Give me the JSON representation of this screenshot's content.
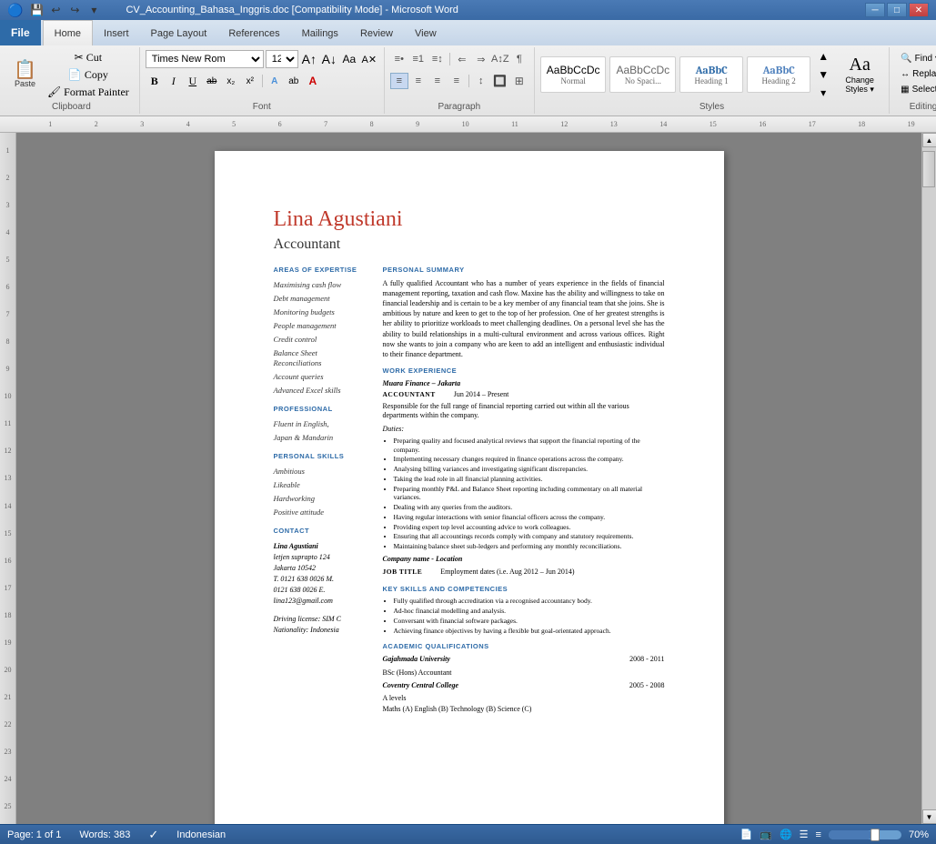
{
  "titlebar": {
    "title": "CV_Accounting_Bahasa_Inggris.doc [Compatibility Mode] - Microsoft Word",
    "minimize": "─",
    "maximize": "□",
    "close": "✕"
  },
  "tabs": {
    "file": "File",
    "home": "Home",
    "insert": "Insert",
    "pageLayout": "Page Layout",
    "references": "References",
    "mailings": "Mailings",
    "review": "Review",
    "view": "View"
  },
  "font": {
    "face": "Times New Rom",
    "size": "12",
    "bold": "B",
    "italic": "I",
    "underline": "U",
    "strikethrough": "ab",
    "subscript": "x₂",
    "superscript": "x²"
  },
  "paragraph": {
    "bullets": "bullets",
    "numbering": "numbering",
    "indent_decrease": "←",
    "indent_increase": "→",
    "sort": "sort",
    "show_marks": "¶"
  },
  "styles": {
    "normal_label": "Normal",
    "normal_sublabel": "¶ Normal",
    "nospace_label": "No Spaci...",
    "nospace_sublabel": "¶ No Spaci...",
    "h1_label": "Heading 1",
    "h1_sublabel": "Heading",
    "h2_label": "Heading 2",
    "h2_sublabel": "Heading",
    "change_styles_label": "Change\nStyles",
    "select_label": "Select ▾"
  },
  "editing": {
    "find": "Find ▾",
    "replace": "Replace",
    "select": "Select ▾",
    "group_label": "Editing"
  },
  "groups": {
    "clipboard": "Clipboard",
    "font": "Font",
    "paragraph": "Paragraph",
    "styles": "Styles",
    "editing": "Editing"
  },
  "document": {
    "name": "Lina Agustiani",
    "title": "Accountant",
    "sections": {
      "left": {
        "areas_header": "AREAS OF EXPERTISE",
        "items": [
          "Maximising cash flow",
          "Debt management",
          "Monitoring budgets",
          "People management",
          "Credit control",
          "Balance Sheet Reconciliations",
          "Account queries",
          "Advanced Excel skills"
        ],
        "professional_header": "PROFESSIONAL",
        "professional_items": [
          "Fluent in English,",
          "Japan & Mandarin"
        ],
        "skills_header": "PERSONAL SKILLS",
        "skills_items": [
          "Ambitious",
          "Likeable",
          "Hardworking",
          "Positive attitude"
        ],
        "contact_header": "CONTACT",
        "contact_info": "Lina Agustiani\nletjen suprapto 124\nJakarta 10542\nT. 0121 638 0026 M.\n0121 638 0026 E.\nlina123@gmail.com",
        "contact_extra": "Driving license: SIM C\nNationality: Indonesia"
      },
      "right": {
        "personal_summary_header": "PERSONAL SUMMARY",
        "personal_summary": "A fully qualified Accountant who has a number of years experience in the fields of financial management reporting, taxation and cash flow. Maxine has the ability and willingness to take on financial leadership and is certain to be a key member of any financial team that she joins. She is ambitious by nature and keen to get to the top of her profession. One of her greatest strengths is her ability to prioritize workloads to meet challenging deadlines. On a personal level she has the ability to build relationships in a multi-cultural environment and across various offices. Right now she wants to join a company who are keen to add an intelligent and enthusiastic individual to their finance department.",
        "work_experience_header": "WORK EXPERIENCE",
        "company1": "Muara Finance – Jakarta",
        "job1_title": "ACCOUNTANT",
        "job1_dates": "Jun 2014 – Present",
        "job1_desc": "Responsible for the full range of financial reporting carried out within all the various departments within the company.",
        "duties_label": "Duties:",
        "duties": [
          "Preparing quality and focused analytical reviews that support the financial reporting of the company.",
          "Implementing necessary changes required in finance operations across the company.",
          "Analysing billing variances and investigating significant discrepancies.",
          "Taking the lead role in all financial planning activities.",
          "Preparing monthly P&L and Balance Sheet reporting including commentary on all material variances.",
          "Dealing with any queries from the auditors.",
          "Having regular interactions with senior financial officers across the company.",
          "Providing expert top level accounting advice to work colleagues.",
          "Ensuring that all accountings records comply with company and statutory requirements.",
          "Maintaining balance sheet sub-ledgers and performing any monthly reconciliations."
        ],
        "company2_label": "Company name - Location",
        "job2_title": "JOB TITLE",
        "job2_dates": "Employment dates (i.e. Aug 2012 – Jun 2014)",
        "key_skills_header": "KEY SKILLS AND COMPETENCIES",
        "key_skills": [
          "Fully qualified through accreditation via a recognised accountancy body.",
          "Ad-hoc financial modelling and analysis.",
          "Conversant with financial software packages.",
          "Achieving finance objectives by having a flexible but goal-orientated approach."
        ],
        "academic_header": "ACADEMIC QUALIFICATIONS",
        "uni": "Gajahmada University",
        "uni_dates": "2008 - 2011",
        "uni_degree": "BSc (Hons)     Accountant",
        "college": "Coventry Central College",
        "college_dates": "2005 - 2008",
        "college_qual": "A levels",
        "college_subjects": "Maths (A) English (B) Technology (B) Science (C)"
      }
    }
  },
  "statusbar": {
    "page": "Page: 1 of 1",
    "words": "Words: 383",
    "language": "Indonesian",
    "zoom": "70%"
  }
}
